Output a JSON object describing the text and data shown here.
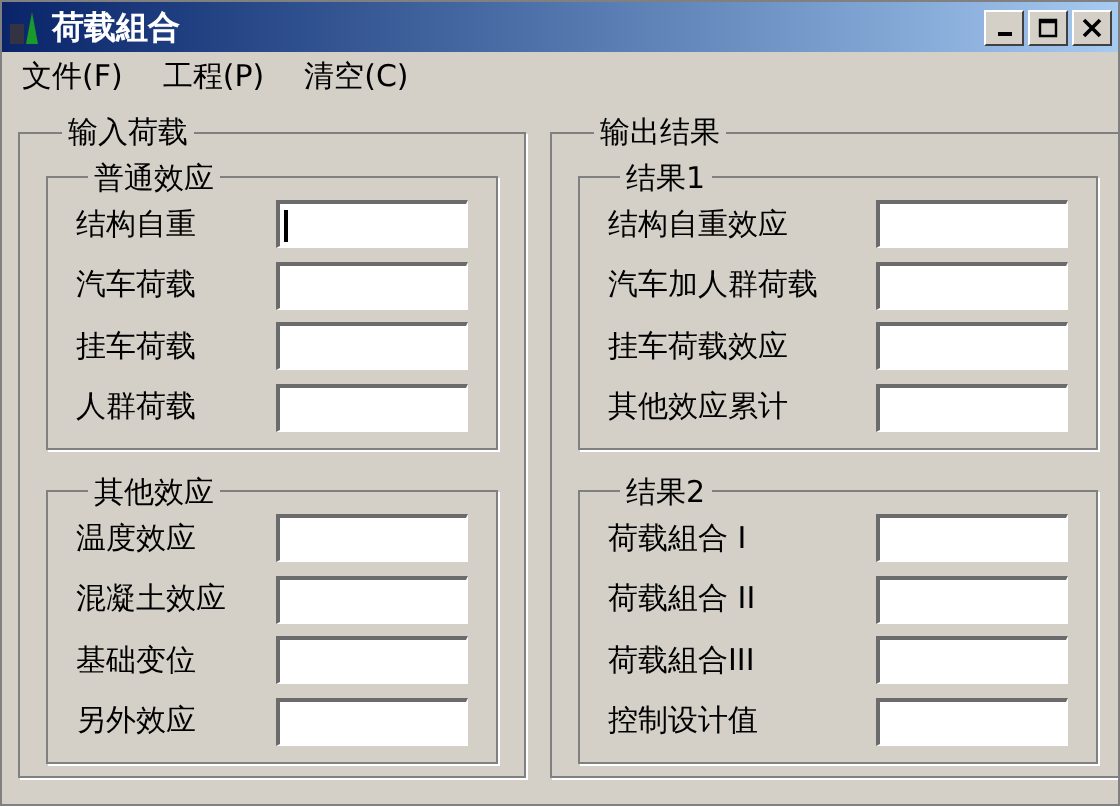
{
  "window": {
    "title": "荷载組合"
  },
  "menu": [
    {
      "label": "文件(F)"
    },
    {
      "label": "工程(P)"
    },
    {
      "label": "清空(C)"
    }
  ],
  "panels": [
    {
      "title": "输入荷载",
      "groups": [
        {
          "title": "普通效应",
          "fields": [
            {
              "label": "结构自重",
              "focused": true
            },
            {
              "label": "汽车荷载",
              "focused": false
            },
            {
              "label": "挂车荷载",
              "focused": false
            },
            {
              "label": "人群荷载",
              "focused": false
            }
          ]
        },
        {
          "title": "其他效应",
          "fields": [
            {
              "label": "温度效应",
              "focused": false
            },
            {
              "label": "混凝土效应",
              "focused": false
            },
            {
              "label": "基础变位",
              "focused": false
            },
            {
              "label": "另外效应",
              "focused": false
            }
          ]
        }
      ]
    },
    {
      "title": "输出结果",
      "groups": [
        {
          "title": "结果1",
          "fields": [
            {
              "label": "结构自重效应",
              "focused": false
            },
            {
              "label": "汽车加人群荷载",
              "focused": false
            },
            {
              "label": "挂车荷载效应",
              "focused": false
            },
            {
              "label": "其他效应累计",
              "focused": false
            }
          ]
        },
        {
          "title": "结果2",
          "fields": [
            {
              "label": "荷载組合 I",
              "focused": false
            },
            {
              "label": "荷载組合 II",
              "focused": false
            },
            {
              "label": "荷载組合III",
              "focused": false
            },
            {
              "label": "控制设计值",
              "focused": false
            }
          ]
        }
      ]
    }
  ]
}
